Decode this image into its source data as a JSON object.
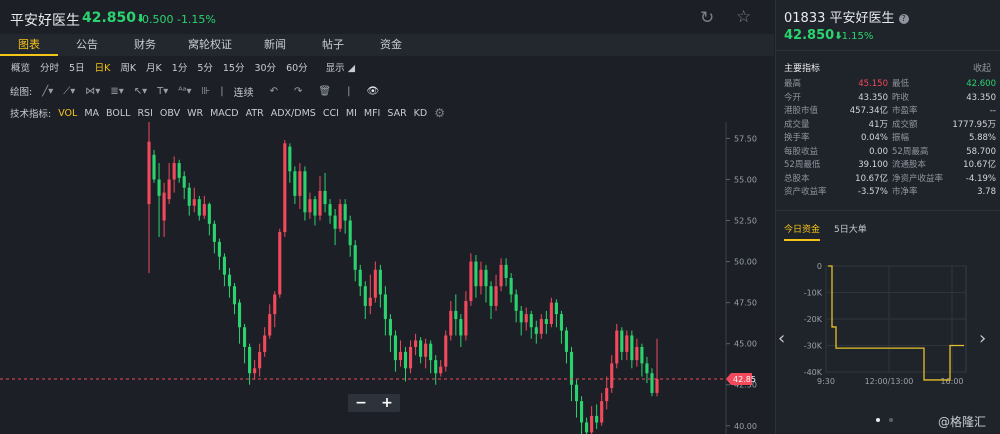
{
  "header": {
    "name": "平安好医生",
    "price": "42.850",
    "change": "-0.500",
    "change_pct": "-1.15%",
    "refresh_icon": "refresh-icon",
    "star_icon": "star-icon"
  },
  "tabs": [
    "图表",
    "公告",
    "财务",
    "窝轮权证",
    "新闻",
    "帖子",
    "资金"
  ],
  "periods": [
    "概览",
    "分时",
    "5日",
    "日K",
    "周K",
    "月K",
    "1分",
    "5分",
    "15分",
    "30分",
    "60分"
  ],
  "display_label": "显示",
  "draw": {
    "label": "绘图:",
    "continuous": "连续"
  },
  "indicators": {
    "label": "技术指标:",
    "items": [
      "VOL",
      "MA",
      "BOLL",
      "RSI",
      "OBV",
      "WR",
      "MACD",
      "ATR",
      "ADX/DMS",
      "CCI",
      "MI",
      "MFI",
      "SAR",
      "KD"
    ]
  },
  "chart_data": {
    "type": "candlestick",
    "y_ticks": [
      "57.50",
      "55.00",
      "52.50",
      "50.00",
      "47.50",
      "45.00",
      "42.50",
      "40.00"
    ],
    "ylim": [
      39.5,
      58.5
    ],
    "current_price": 42.85,
    "current_price_label": "42.85",
    "up_color": "#f2495c",
    "down_color": "#2bd36f",
    "candles": [
      [
        53.5,
        57.3,
        58.5,
        49.3
      ],
      [
        56.5,
        55.0,
        56.8,
        54.8
      ],
      [
        55.0,
        54.0,
        56.0,
        51.5
      ],
      [
        52.5,
        54.2,
        54.8,
        51.5
      ],
      [
        53.8,
        55.0,
        56.0,
        53.5
      ],
      [
        55.0,
        56.0,
        56.4,
        54.2
      ],
      [
        56.0,
        55.1,
        56.2,
        54.8
      ],
      [
        55.2,
        54.5,
        55.5,
        53.8
      ],
      [
        54.5,
        53.4,
        54.8,
        52.8
      ],
      [
        53.4,
        53.8,
        54.5,
        53.0
      ],
      [
        53.8,
        52.8,
        54.0,
        52.5
      ],
      [
        52.8,
        53.5,
        54.0,
        52.6
      ],
      [
        53.5,
        52.3,
        53.6,
        51.6
      ],
      [
        52.3,
        51.2,
        52.5,
        50.5
      ],
      [
        51.2,
        50.3,
        51.4,
        49.5
      ],
      [
        50.3,
        49.2,
        50.5,
        48.5
      ],
      [
        49.2,
        48.5,
        49.6,
        47.8
      ],
      [
        48.5,
        47.4,
        48.7,
        46.8
      ],
      [
        47.5,
        46.0,
        47.7,
        45.0
      ],
      [
        46.0,
        44.8,
        46.2,
        43.8
      ],
      [
        44.8,
        43.2,
        45.0,
        42.5
      ],
      [
        43.2,
        43.5,
        44.0,
        42.8
      ],
      [
        43.5,
        44.5,
        45.0,
        43.0
      ],
      [
        44.5,
        45.5,
        46.0,
        44.2
      ],
      [
        45.5,
        46.8,
        47.4,
        45.3
      ],
      [
        46.8,
        48.0,
        48.2,
        46.0
      ],
      [
        48.0,
        51.8,
        52.0,
        47.8
      ],
      [
        51.8,
        57.2,
        57.4,
        51.5
      ],
      [
        57.0,
        55.5,
        57.2,
        54.8
      ],
      [
        55.5,
        54.0,
        55.8,
        53.5
      ],
      [
        54.0,
        55.5,
        56.0,
        53.2
      ],
      [
        55.5,
        53.0,
        55.8,
        52.5
      ],
      [
        53.0,
        53.8,
        54.2,
        52.6
      ],
      [
        53.8,
        52.8,
        54.0,
        52.2
      ],
      [
        52.8,
        54.3,
        55.2,
        52.5
      ],
      [
        54.3,
        53.5,
        55.4,
        53.0
      ],
      [
        53.5,
        52.8,
        53.8,
        52.3
      ],
      [
        52.8,
        52.0,
        53.2,
        51.0
      ],
      [
        52.0,
        53.5,
        53.8,
        51.8
      ],
      [
        53.5,
        52.5,
        53.8,
        51.7
      ],
      [
        52.5,
        51.0,
        52.8,
        50.3
      ],
      [
        51.0,
        49.5,
        51.3,
        48.8
      ],
      [
        49.5,
        48.5,
        49.8,
        47.9
      ],
      [
        48.5,
        47.3,
        48.8,
        46.5
      ],
      [
        47.3,
        47.8,
        49.2,
        46.8
      ],
      [
        47.8,
        49.5,
        50.0,
        47.5
      ],
      [
        49.5,
        48.0,
        49.8,
        47.2
      ],
      [
        48.0,
        46.5,
        48.5,
        45.5
      ],
      [
        46.5,
        45.5,
        46.8,
        44.5
      ],
      [
        45.5,
        44.0,
        45.8,
        43.3
      ],
      [
        44.0,
        44.5,
        45.2,
        43.6
      ],
      [
        44.5,
        43.5,
        44.8,
        42.7
      ],
      [
        43.5,
        44.8,
        45.2,
        43.2
      ],
      [
        44.8,
        45.2,
        45.6,
        44.3
      ],
      [
        45.2,
        44.2,
        45.4,
        43.8
      ],
      [
        44.2,
        45.0,
        45.3,
        43.5
      ],
      [
        45.0,
        44.0,
        45.2,
        43.2
      ],
      [
        44.0,
        43.2,
        44.3,
        42.5
      ],
      [
        43.2,
        43.6,
        44.0,
        43.0
      ],
      [
        43.6,
        45.5,
        45.8,
        43.3
      ],
      [
        45.5,
        47.0,
        47.6,
        45.2
      ],
      [
        47.0,
        46.5,
        48.0,
        45.5
      ],
      [
        46.5,
        45.5,
        46.8,
        44.8
      ],
      [
        45.5,
        47.6,
        48.2,
        45.2
      ],
      [
        47.6,
        50.0,
        50.5,
        47.3
      ],
      [
        50.0,
        48.5,
        50.4,
        47.8
      ],
      [
        48.5,
        49.5,
        50.0,
        48.0
      ],
      [
        49.5,
        48.5,
        49.8,
        47.5
      ],
      [
        48.5,
        47.3,
        48.8,
        46.5
      ],
      [
        47.3,
        48.5,
        49.2,
        47.0
      ],
      [
        48.5,
        49.8,
        50.2,
        48.2
      ],
      [
        49.8,
        49.0,
        50.2,
        48.5
      ],
      [
        49.0,
        48.0,
        49.3,
        47.5
      ],
      [
        48.0,
        47.0,
        48.3,
        46.3
      ],
      [
        47.0,
        46.3,
        47.3,
        45.5
      ],
      [
        46.3,
        46.8,
        47.2,
        45.8
      ],
      [
        46.8,
        46.0,
        47.0,
        45.3
      ],
      [
        46.0,
        45.6,
        46.4,
        45.0
      ],
      [
        45.6,
        46.5,
        46.8,
        45.3
      ],
      [
        46.5,
        46.2,
        47.0,
        45.6
      ],
      [
        46.2,
        47.5,
        47.8,
        46.0
      ],
      [
        47.5,
        46.8,
        47.7,
        46.0
      ],
      [
        46.8,
        45.8,
        47.0,
        45.0
      ],
      [
        45.8,
        44.5,
        46.0,
        43.8
      ],
      [
        44.5,
        42.5,
        44.8,
        41.5
      ],
      [
        42.5,
        41.5,
        42.8,
        40.5
      ],
      [
        41.5,
        40.2,
        41.8,
        39.3
      ],
      [
        40.2,
        39.6,
        40.5,
        39.3
      ],
      [
        39.6,
        40.6,
        41.2,
        39.4
      ],
      [
        40.6,
        40.2,
        41.3,
        39.8
      ],
      [
        40.2,
        41.5,
        42.0,
        40.0
      ],
      [
        41.5,
        42.3,
        43.0,
        41.0
      ],
      [
        42.3,
        43.8,
        44.3,
        42.0
      ],
      [
        43.8,
        45.8,
        46.2,
        43.5
      ],
      [
        45.8,
        44.5,
        46.0,
        44.0
      ],
      [
        44.5,
        45.5,
        45.8,
        44.0
      ],
      [
        45.5,
        44.0,
        45.8,
        43.5
      ],
      [
        44.0,
        44.8,
        45.3,
        43.6
      ],
      [
        44.8,
        43.8,
        45.0,
        43.0
      ],
      [
        43.8,
        43.2,
        44.2,
        42.6
      ],
      [
        43.2,
        42.0,
        43.5,
        41.8
      ],
      [
        42.0,
        42.85,
        45.3,
        41.8
      ]
    ]
  },
  "right": {
    "code": "01833",
    "name": "平安好医生",
    "price": "42.850",
    "change_pct": "-1.15%",
    "section_title": "主要指标",
    "collapse": "收起",
    "stats": [
      [
        "最高",
        "45.150",
        "最低",
        "42.600"
      ],
      [
        "今开",
        "43.350",
        "昨收",
        "43.350"
      ],
      [
        "港股市值",
        "457.34亿",
        "市盈率",
        "--"
      ],
      [
        "成交量",
        "41万",
        "成交额",
        "1777.95万"
      ],
      [
        "换手率",
        "0.04%",
        "振幅",
        "5.88%"
      ],
      [
        "每股收益",
        "0.00",
        "52周最高",
        "58.700"
      ],
      [
        "52周最低",
        "39.100",
        "流通股本",
        "10.67亿"
      ],
      [
        "总股本",
        "10.67亿",
        "净资产收益率",
        "-4.19%"
      ],
      [
        "资产收益率",
        "-3.57%",
        "市净率",
        "3.78"
      ]
    ],
    "fund_tabs": [
      "今日资金",
      "5日大单"
    ],
    "flow": {
      "y_ticks": [
        "0",
        "-10K",
        "-20K",
        "-30K",
        "-40K"
      ],
      "x_ticks": [
        "9:30",
        "12:00/13:00",
        "16:00"
      ]
    },
    "watermark": "@格隆汇"
  }
}
